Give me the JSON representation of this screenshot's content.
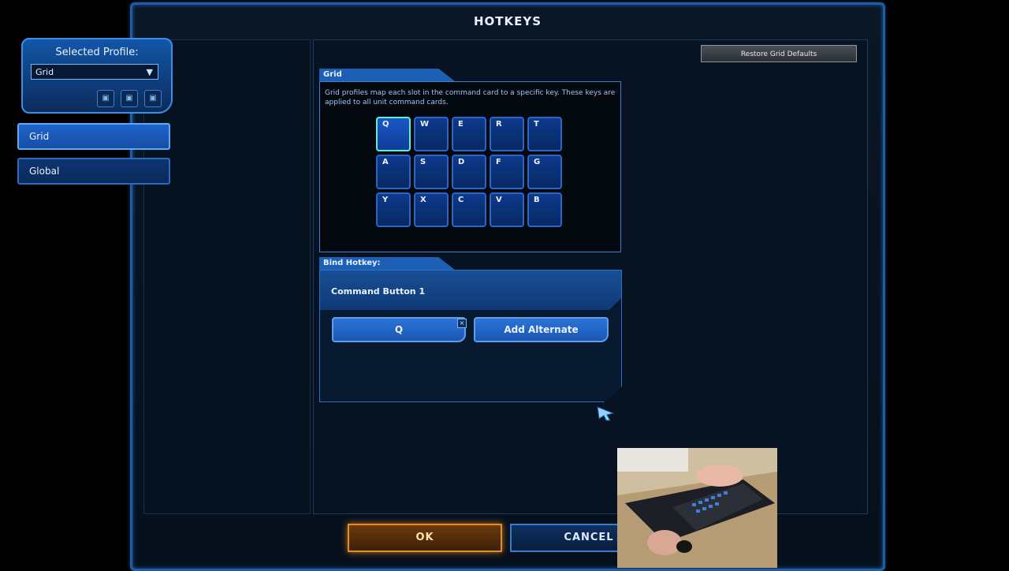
{
  "window": {
    "title": "HOTKEYS"
  },
  "profile": {
    "label": "Selected Profile:",
    "selected": "Grid"
  },
  "nav": {
    "items": [
      {
        "label": "Grid",
        "active": true
      },
      {
        "label": "Global",
        "active": false
      }
    ]
  },
  "toolbar": {
    "restore_label": "Restore Grid Defaults"
  },
  "grid": {
    "tab_label": "Grid",
    "description": "Grid profiles map each slot in the command card to a specific key. These keys are applied to all unit command cards.",
    "keys": [
      "Q",
      "W",
      "E",
      "R",
      "T",
      "A",
      "S",
      "D",
      "F",
      "G",
      "Y",
      "X",
      "C",
      "V",
      "B"
    ],
    "selected_key": "Q"
  },
  "bind": {
    "tab_label": "Bind Hotkey:",
    "command_name": "Command Button 1",
    "primary_key": "Q",
    "alternate_label": "Add Alternate"
  },
  "footer": {
    "ok_label": "OK",
    "cancel_label": "CANCEL"
  },
  "colors": {
    "accent": "#1f5ea6",
    "ok": "#e08f2a",
    "selected_key_border": "#5ff0d0"
  }
}
